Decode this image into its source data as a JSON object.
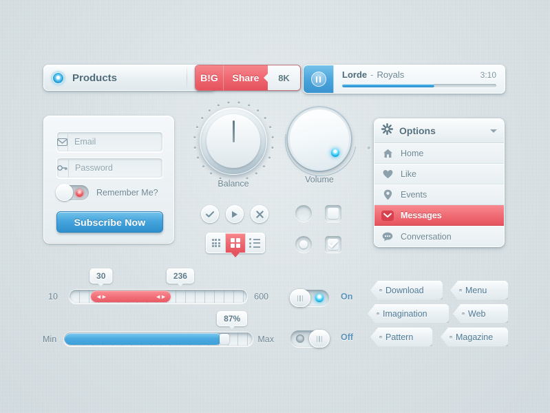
{
  "theme": {
    "background": "#d8e0e3",
    "accent_blue": "#3ba3dd",
    "accent_red": "#ef6a73",
    "text": "#6d8794"
  },
  "products_select": {
    "label": "Products",
    "led_icon": "led-circle-icon",
    "caret_icon": "chevron-down-icon"
  },
  "share_widget": {
    "logo": "B!G",
    "label": "Share",
    "count": "8K"
  },
  "media_player": {
    "play_icon": "pause-icon",
    "artist": "Lorde",
    "separator": "-",
    "title": "Royals",
    "time": "3:10",
    "progress_percent": 60
  },
  "login": {
    "email": {
      "value": "",
      "placeholder": "Email",
      "icon": "envelope-icon"
    },
    "password": {
      "value": "",
      "placeholder": "Password",
      "icon": "key-icon"
    },
    "remember_label": "Remember Me?",
    "remember_on": false,
    "subscribe_label": "Subscribe Now"
  },
  "knobs": [
    {
      "label": "Balance",
      "name": "balance-knob"
    },
    {
      "label": "Volume",
      "name": "volume-knob"
    }
  ],
  "round_buttons": [
    {
      "name": "check-button",
      "icon": "check-icon"
    },
    {
      "name": "play-button",
      "icon": "play-icon"
    },
    {
      "name": "close-button",
      "icon": "close-icon"
    }
  ],
  "view_segment": {
    "options": [
      {
        "name": "grid-small-view",
        "icon": "grid-small-icon",
        "active": false
      },
      {
        "name": "grid-large-view",
        "icon": "grid-large-icon",
        "active": true
      },
      {
        "name": "list-view",
        "icon": "list-icon",
        "active": false
      }
    ]
  },
  "toggles_inset": {
    "radio_empty": false,
    "radio_selected": true,
    "checkbox_empty": false,
    "checkbox_checked": true
  },
  "options_menu": {
    "header": {
      "title": "Options",
      "icon": "gear-icon",
      "caret": "chevron-down-icon"
    },
    "items": [
      {
        "label": "Home",
        "icon": "home-icon",
        "active": false
      },
      {
        "label": "Like",
        "icon": "heart-icon",
        "active": false
      },
      {
        "label": "Events",
        "icon": "map-pin-icon",
        "active": false
      },
      {
        "label": "Messages",
        "icon": "envelope-icon",
        "active": true
      },
      {
        "label": "Conversation",
        "icon": "speech-bubble-icon",
        "active": false
      }
    ]
  },
  "range_slider": {
    "min_label": "10",
    "max_label": "600",
    "low_value": "30",
    "high_value": "236",
    "low_percent": 12,
    "high_percent": 57
  },
  "progress_slider": {
    "min_label": "Min",
    "max_label": "Max",
    "value_label": "87%",
    "percent": 87
  },
  "switches": [
    {
      "label": "On",
      "state": "on"
    },
    {
      "label": "Off",
      "state": "off"
    }
  ],
  "tag_buttons": [
    {
      "label": "Download"
    },
    {
      "label": "Menu"
    },
    {
      "label": "Imagination"
    },
    {
      "label": "Web"
    },
    {
      "label": "Pattern"
    },
    {
      "label": "Magazine"
    }
  ]
}
